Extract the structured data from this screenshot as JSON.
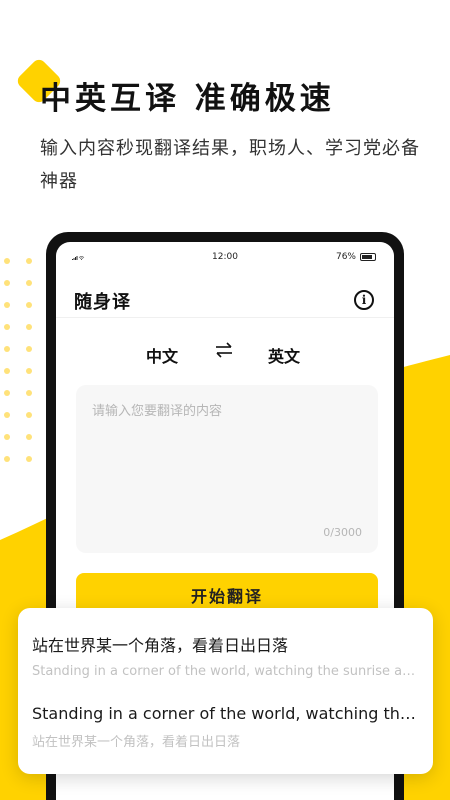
{
  "colors": {
    "accent": "#FFD200",
    "dots": "#FFE27A",
    "text_primary": "#1a1a1a",
    "text_muted": "#b6b6b6"
  },
  "headline": "中英互译  准确极速",
  "subtitle": "输入内容秒现翻译结果，职场人、学习党必备神器",
  "phone": {
    "status_bar": {
      "time": "12:00",
      "battery": "76%"
    },
    "app_title": "随身译",
    "info_icon": "info-icon",
    "source_lang": "中文",
    "swap_icon": "swap-arrows-icon",
    "target_lang": "英文",
    "input": {
      "placeholder": "请输入您要翻译的内容",
      "counter": "0/3000"
    },
    "translate_button": "开始翻译"
  },
  "history": [
    {
      "main": "站在世界某一个角落，看着日出日落",
      "sub": "Standing in a corner of the world, watching the sunrise and sunset"
    },
    {
      "main": "Standing in a corner of the world, watching the sunrise and sunset",
      "sub": "站在世界某一个角落，看着日出日落"
    }
  ]
}
